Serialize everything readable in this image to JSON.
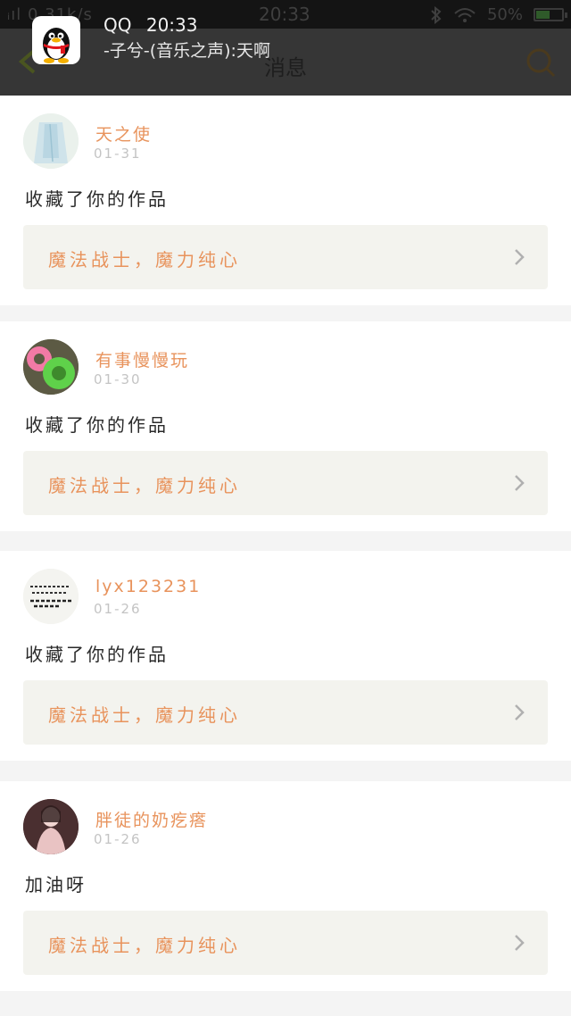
{
  "status_bar": {
    "signal": "ᵢıl 0.31k/s",
    "time": "20:33",
    "battery": "50%",
    "battery_level": 0.5
  },
  "header": {
    "title": "消息"
  },
  "notification": {
    "app": "QQ",
    "time": "20:33",
    "text": "-子兮-(音乐之声):天啊"
  },
  "messages": [
    {
      "username": "天之使",
      "date": "01-31",
      "action": "收藏了你的作品",
      "work_title": "魔法战士，魔力纯心"
    },
    {
      "username": "有事慢慢玩",
      "date": "01-30",
      "action": "收藏了你的作品",
      "work_title": "魔法战士，魔力纯心"
    },
    {
      "username": "lyx123231",
      "date": "01-26",
      "action": "收藏了你的作品",
      "work_title": "魔法战士，魔力纯心"
    },
    {
      "username": "胖徒的奶疙瘩",
      "date": "01-26",
      "action": "加油呀",
      "work_title": "魔法战士，魔力纯心"
    }
  ],
  "colors": {
    "accent": "#e8935c",
    "header_bg": "#363636",
    "card_bg": "#ffffff",
    "work_bg": "#f3f3ee"
  }
}
